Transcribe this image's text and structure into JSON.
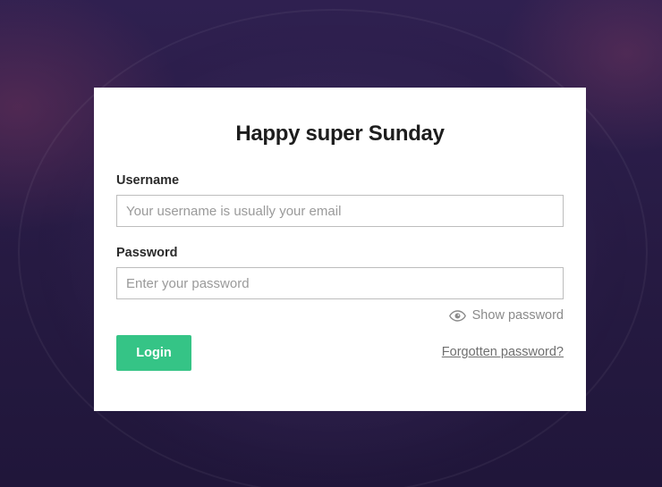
{
  "login": {
    "title": "Happy super Sunday",
    "username_label": "Username",
    "username_placeholder": "Your username is usually your email",
    "username_value": "",
    "password_label": "Password",
    "password_placeholder": "Enter your password",
    "password_value": "",
    "show_password_icon": "eye-icon",
    "show_password_label": "Show password",
    "login_button_label": "Login",
    "forgot_link": "Forgotten password?"
  },
  "colors": {
    "primary_button": "#35c486",
    "background": "#2a1c45",
    "card": "#ffffff"
  }
}
